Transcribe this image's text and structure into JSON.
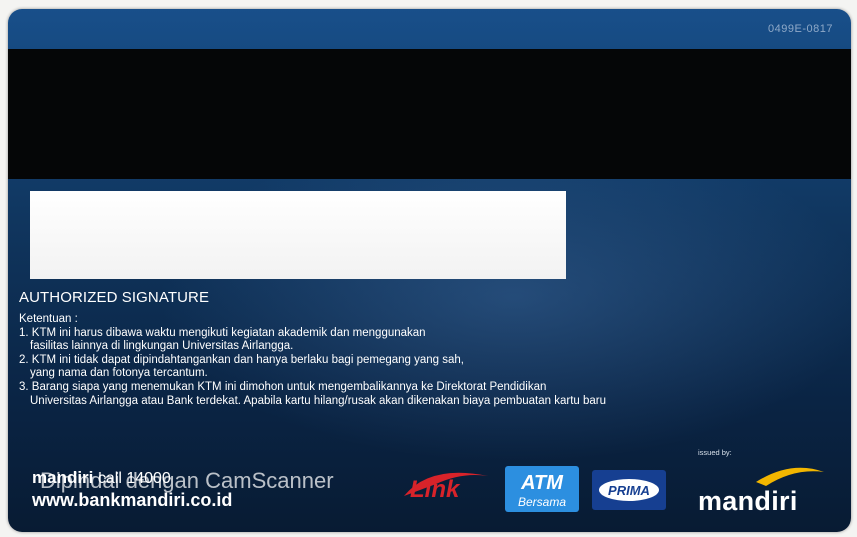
{
  "card": {
    "serial": "0499E-0817",
    "signature_label": "AUTHORIZED SIGNATURE",
    "terms_heading": "Ketentuan :",
    "terms_lines": [
      "1. KTM ini harus dibawa waktu mengikuti kegiatan akademik dan menggunakan",
      "fasilitas lainnya di lingkungan Universitas Airlangga.",
      "2. KTM ini tidak dapat dipindahtangankan dan hanya berlaku bagi pemegang yang sah,",
      "yang nama dan fotonya tercantum.",
      "3. Barang siapa yang menemukan KTM ini dimohon untuk mengembalikannya ke Direktorat Pendidikan",
      "Universitas Airlangga atau Bank terdekat. Apabila kartu hilang/rusak akan dikenakan biaya pembuatan kartu baru"
    ],
    "issued_by": "issued by:"
  },
  "footer": {
    "brand": "mandiri",
    "call": "call 14000",
    "url": "www.bankmandiri.co.id",
    "watermark": "Dipindai dengan CamScanner"
  },
  "logos": {
    "link": "Link",
    "atm_top": "ATM",
    "atm_bottom": "Bersama",
    "prima": "PRIMA",
    "mandiri": "mandiri"
  },
  "colors": {
    "card_blue": "#10365f",
    "mandiri_yellow": "#f2b600",
    "link_red": "#d8232a",
    "atm_blue": "#2c8fe0",
    "prima_blue": "#163f91"
  }
}
